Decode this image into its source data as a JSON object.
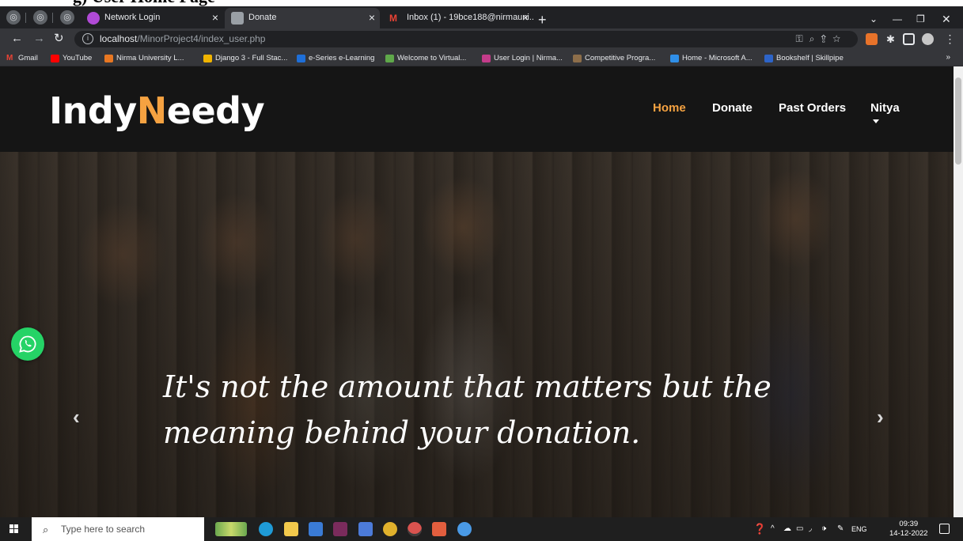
{
  "doc_caption": "g) User Home Page",
  "browser": {
    "tabs": [
      {
        "label": "Network Login",
        "active": false
      },
      {
        "label": "Donate",
        "active": true
      },
      {
        "label": "Inbox (1) - 19bce188@nirmauni...",
        "active": false
      }
    ],
    "url_host": "localhost",
    "url_path": "/MinorProject4/index_user.php",
    "bookmarks": [
      "Gmail",
      "YouTube",
      "Nirma University L...",
      "Django 3 - Full Stac...",
      "e-Series e-Learning",
      "Welcome to Virtual...",
      "User Login | Nirma...",
      "Competitive Progra...",
      "Home - Microsoft A...",
      "Bookshelf | Skillpipe"
    ]
  },
  "site": {
    "logo_part1": "Indy",
    "logo_part2": "N",
    "logo_part3": "eedy",
    "nav": {
      "home": "Home",
      "donate": "Donate",
      "past_orders": "Past Orders",
      "user": "Nitya"
    },
    "hero_quote_line1": "It's not the amount that matters but the",
    "hero_quote_line2": "meaning behind your donation.",
    "accent_color": "#f5a241",
    "whatsapp_color": "#25d366"
  },
  "taskbar": {
    "search_placeholder": "Type here to search",
    "language": "ENG",
    "time": "09:39",
    "date": "14-12-2022"
  }
}
